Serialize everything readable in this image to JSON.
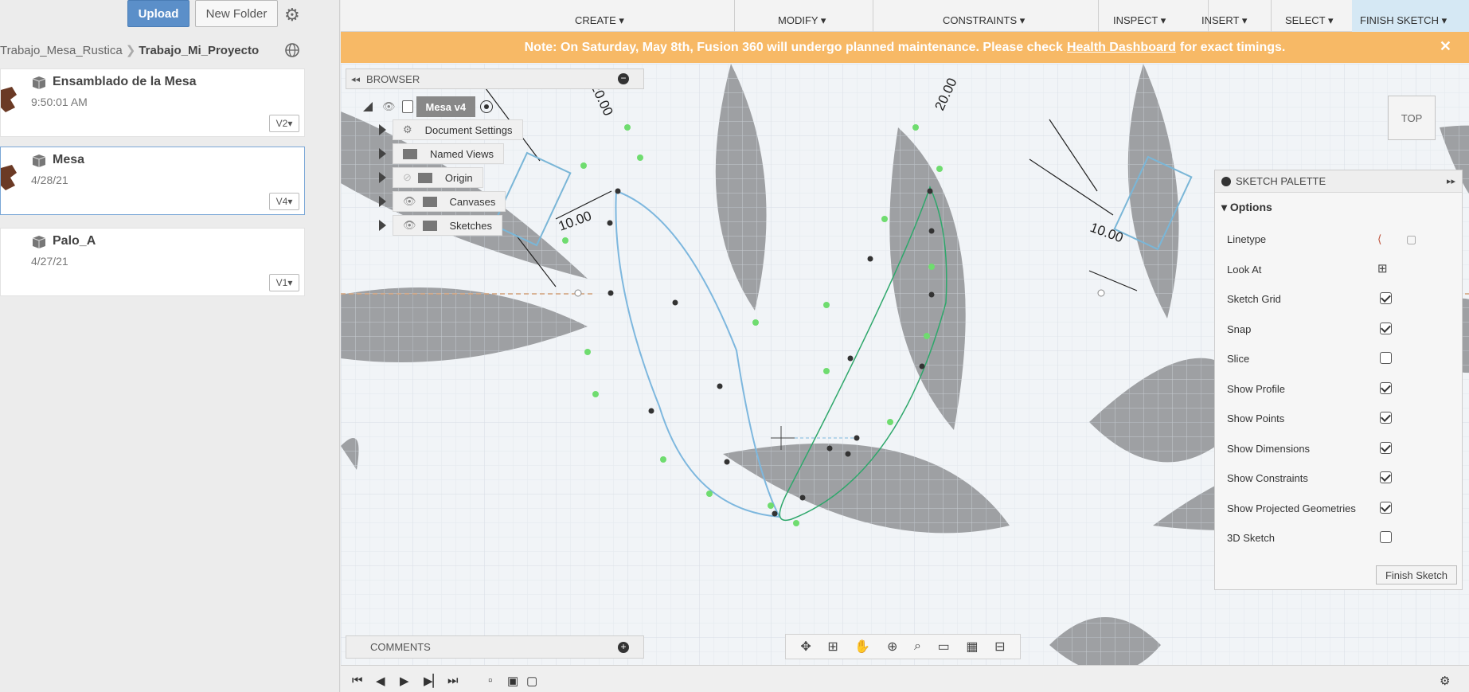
{
  "data_panel": {
    "upload_label": "Upload",
    "new_folder_label": "New Folder",
    "breadcrumb": {
      "parent": "Trabajo_Mesa_Rustica",
      "current": "Trabajo_Mi_Proyecto"
    },
    "files": [
      {
        "name": "Ensamblado de la Mesa",
        "date": "9:50:01 AM",
        "version": "V2▾"
      },
      {
        "name": "Mesa",
        "date": "4/28/21",
        "version": "V4▾"
      },
      {
        "name": "Palo_A",
        "date": "4/27/21",
        "version": "V1▾"
      }
    ]
  },
  "toolbar": {
    "groups": [
      "CREATE ▾",
      "MODIFY ▾",
      "CONSTRAINTS ▾",
      "INSPECT ▾",
      "INSERT ▾",
      "SELECT ▾",
      "FINISH SKETCH ▾"
    ]
  },
  "banner": {
    "prefix": "Note: On Saturday, May 8th, Fusion 360 will undergo planned maintenance. Please check",
    "link": "Health Dashboard",
    "suffix": "for exact timings.",
    "close": "✕"
  },
  "browser": {
    "title": "BROWSER",
    "root": "Mesa v4",
    "items": [
      "Document Settings",
      "Named Views",
      "Origin",
      "Canvases",
      "Sketches"
    ]
  },
  "sketch_palette": {
    "title": "SKETCH PALETTE",
    "section": "Options",
    "rows": [
      {
        "label": "Linetype"
      },
      {
        "label": "Look At"
      },
      {
        "label": "Sketch Grid",
        "checked": true
      },
      {
        "label": "Snap",
        "checked": true
      },
      {
        "label": "Slice",
        "checked": false
      },
      {
        "label": "Show Profile",
        "checked": true
      },
      {
        "label": "Show Points",
        "checked": true
      },
      {
        "label": "Show Dimensions",
        "checked": true
      },
      {
        "label": "Show Constraints",
        "checked": true
      },
      {
        "label": "Show Projected Geometries",
        "checked": true
      },
      {
        "label": "3D Sketch",
        "checked": false
      }
    ],
    "finish_label": "Finish Sketch"
  },
  "comments": {
    "title": "COMMENTS"
  },
  "viewcube": {
    "face": "TOP"
  },
  "dimensions": [
    "20.00",
    "10.00",
    "20.00",
    "10.00"
  ]
}
